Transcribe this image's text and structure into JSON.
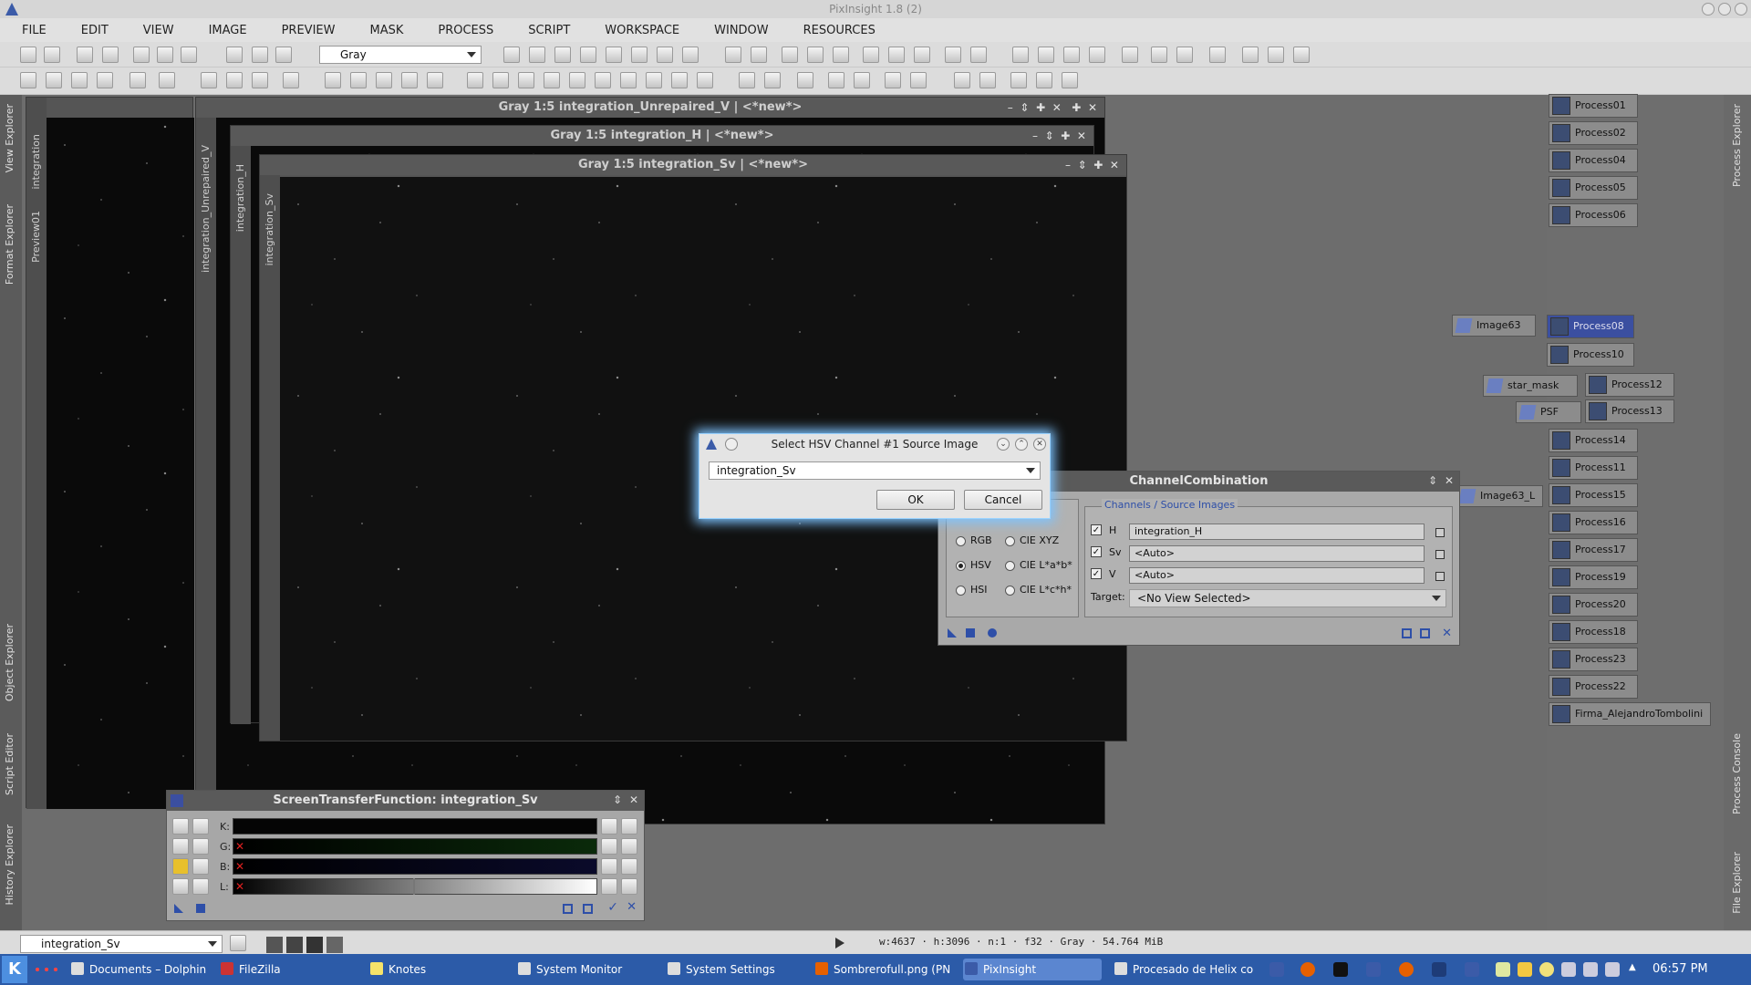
{
  "window_title": "PixInsight 1.8 (2)",
  "menu": [
    "FILE",
    "EDIT",
    "VIEW",
    "IMAGE",
    "PREVIEW",
    "MASK",
    "PROCESS",
    "SCRIPT",
    "WORKSPACE",
    "WINDOW",
    "RESOURCES"
  ],
  "toolbar": {
    "mask_combo": "Gray"
  },
  "left_dock_tabs": [
    "View Explorer",
    "Format Explorer",
    "Object Explorer",
    "Script Editor",
    "History Explorer"
  ],
  "right_dock_tabs": [
    "Process Explorer",
    "Process Console",
    "File Explorer"
  ],
  "image_windows": [
    {
      "title": "Gray 1:5 integration_Unrepaired_V | <*new*>",
      "side_label": "integration_Unrepaired_V"
    },
    {
      "title": "Gray 1:5 integration_H | <*new*>",
      "side_label": "integration_H"
    },
    {
      "title": "Gray 1:5 integration_Sv | <*new*>",
      "side_label": "integration_Sv"
    }
  ],
  "back_tabs": [
    "integration",
    "Preview01"
  ],
  "process_icons": [
    {
      "label": "Process01"
    },
    {
      "label": "Process02"
    },
    {
      "label": "Process04"
    },
    {
      "label": "Process05"
    },
    {
      "label": "Process06"
    },
    {
      "label": "Process08"
    },
    {
      "label": "Process10"
    },
    {
      "label": "Process12"
    },
    {
      "label": "Process13"
    },
    {
      "label": "Process14"
    },
    {
      "label": "Process11"
    },
    {
      "label": "Process15"
    },
    {
      "label": "Process16"
    },
    {
      "label": "Process17"
    },
    {
      "label": "Process19"
    },
    {
      "label": "Process20"
    },
    {
      "label": "Process18"
    },
    {
      "label": "Process23"
    },
    {
      "label": "Process22"
    },
    {
      "label": "Firma_AlejandroTombolini"
    }
  ],
  "image_icons": [
    {
      "label": "Image63"
    },
    {
      "label": "star_mask"
    },
    {
      "label": "PSF"
    },
    {
      "label": "Image63_L"
    }
  ],
  "channel_combination": {
    "title": "ChannelCombination",
    "group_title": "Channels / Source Images",
    "color_spaces": [
      "RGB",
      "CIE XYZ",
      "HSV",
      "CIE L*a*b*",
      "HSI",
      "CIE L*c*h*"
    ],
    "selected_space": "HSV",
    "channels": [
      {
        "name": "H",
        "source": "integration_H",
        "checked": true
      },
      {
        "name": "Sv",
        "source": "<Auto>",
        "checked": true
      },
      {
        "name": "V",
        "source": "<Auto>",
        "checked": true
      }
    ],
    "target_label": "Target:",
    "target_value": "<No View Selected>"
  },
  "dialog": {
    "title": "Select HSV Channel #1 Source Image",
    "selected": "integration_Sv",
    "ok": "OK",
    "cancel": "Cancel"
  },
  "stf": {
    "title": "ScreenTransferFunction: integration_Sv",
    "channels": [
      "K:",
      "G:",
      "B:",
      "L:"
    ]
  },
  "statusbar": {
    "view_combo": "integration_Sv",
    "info": "w:4637 · h:3096 · n:1 · f32 · Gray · 54.764 MiB"
  },
  "taskbar": {
    "items": [
      "Documents – Dolphin",
      "FileZilla",
      "Knotes",
      "System Monitor",
      "System Settings",
      "Sombrerofull.png (PN",
      "PixInsight",
      "Procesado de Helix co"
    ],
    "active": "PixInsight",
    "clock": "06:57 PM"
  },
  "colors": {
    "accent": "#3b4fa0",
    "dialog_glow": "#7dc3ff",
    "taskbar": "#2c5ba8"
  }
}
